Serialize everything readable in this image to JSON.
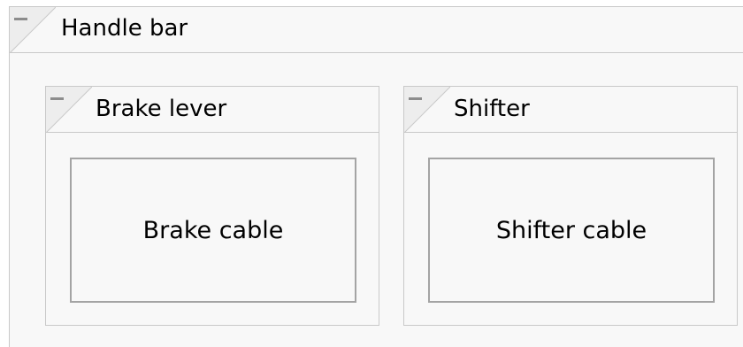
{
  "colors": {
    "panel_background": "#f8f8f8",
    "panel_border": "#c9c9c9",
    "leaf_border": "#a4a4a4",
    "collapse_icon": "#8c8c8c"
  },
  "outer_group": {
    "title": "Handle bar",
    "icon": "collapse-icon",
    "children": [
      {
        "title": "Brake lever",
        "icon": "collapse-icon",
        "leaf": "Brake cable"
      },
      {
        "title": "Shifter",
        "icon": "collapse-icon",
        "leaf": "Shifter cable"
      }
    ]
  }
}
